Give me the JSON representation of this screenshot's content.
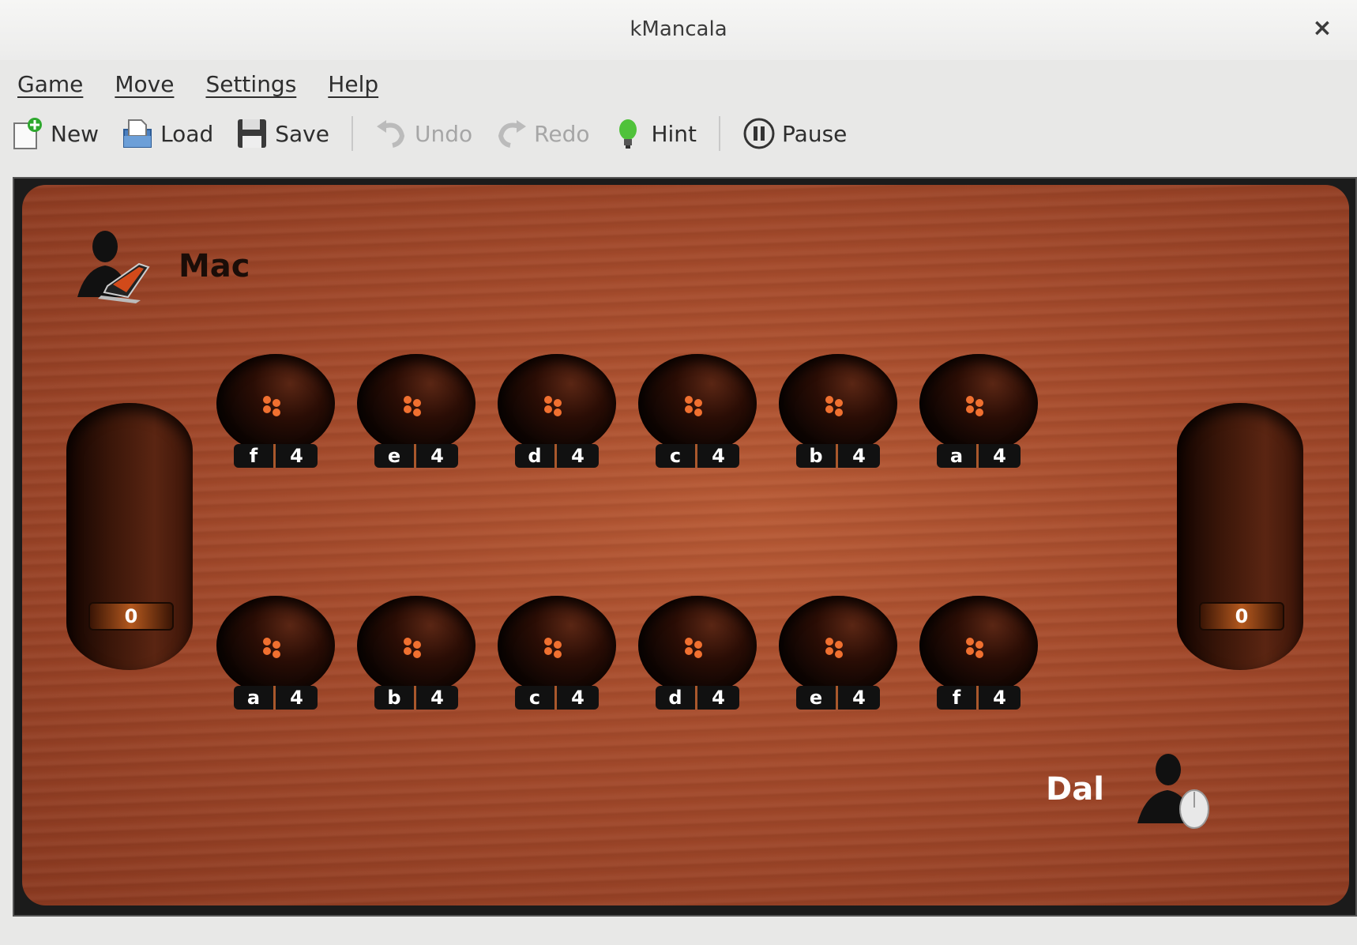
{
  "window": {
    "title": "kMancala",
    "close": "×"
  },
  "menu": [
    "Game",
    "Move",
    "Settings",
    "Help"
  ],
  "toolbar": {
    "new": "New",
    "load": "Load",
    "save": "Save",
    "undo": "Undo",
    "redo": "Redo",
    "hint": "Hint",
    "pause": "Pause"
  },
  "players": {
    "top": {
      "name": "Mac",
      "type": "computer"
    },
    "bottom": {
      "name": "Dal",
      "type": "human"
    }
  },
  "board": {
    "top_pits": [
      {
        "letter": "f",
        "count": "4"
      },
      {
        "letter": "e",
        "count": "4"
      },
      {
        "letter": "d",
        "count": "4"
      },
      {
        "letter": "c",
        "count": "4"
      },
      {
        "letter": "b",
        "count": "4"
      },
      {
        "letter": "a",
        "count": "4"
      }
    ],
    "bottom_pits": [
      {
        "letter": "a",
        "count": "4"
      },
      {
        "letter": "b",
        "count": "4"
      },
      {
        "letter": "c",
        "count": "4"
      },
      {
        "letter": "d",
        "count": "4"
      },
      {
        "letter": "e",
        "count": "4"
      },
      {
        "letter": "f",
        "count": "4"
      }
    ],
    "left_store": "0",
    "right_store": "0"
  },
  "colors": {
    "board": "#a44a2b",
    "seed": "#f07030",
    "pit_label_divider": "#a9582c"
  }
}
